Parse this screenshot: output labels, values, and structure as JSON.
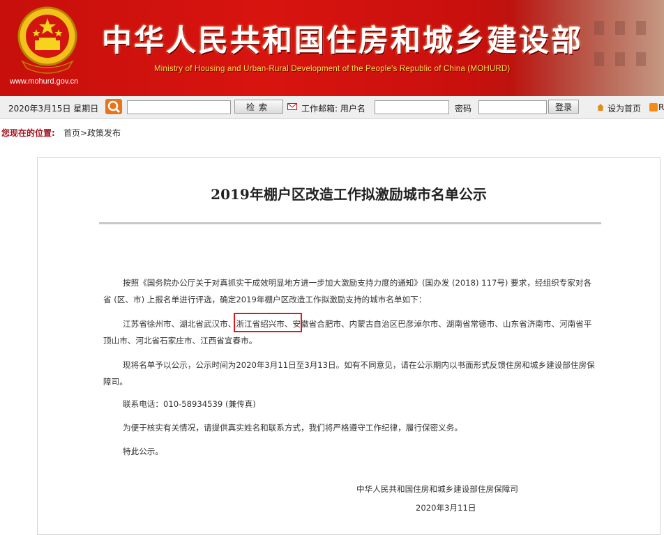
{
  "header": {
    "title": "中华人民共和国住房和城乡建设部",
    "subtitle": "Ministry of Housing and Urban-Rural Development of the People's Republic of China (MOHURD)",
    "url": "www.mohurd.gov.cn"
  },
  "toolbar": {
    "date": "2020年3月15日  星期日",
    "search_button": "检索",
    "mail_label": "工作邮箱: 用户名",
    "password_label": "密码",
    "login_button": "登录",
    "set_home": "设为首页",
    "more": "R"
  },
  "breadcrumb": {
    "label": "您现在的位置:",
    "path": "首页>政策发布"
  },
  "article": {
    "title": "2019年棚户区改造工作拟激励城市名单公示",
    "paragraphs": [
      "按照《国务院办公厅关于对真抓实干成效明显地方进一步加大激励支持力度的通知》(国办发 (2018) 117号) 要求，经组织专家对各省 (区、市) 上报名单进行评选，确定2019年棚户区改造工作拟激励支持的城市名单如下：",
      "江苏省徐州市、湖北省武汉市、浙江省绍兴市、安徽省合肥市、内蒙古自治区巴彦淖尔市、湖南省常德市、山东省济南市、河南省平顶山市、河北省石家庄市、江西省宜春市。",
      "现将名单予以公示，公示时间为2020年3月11日至3月13日。如有不同意见，请在公示期内以书面形式反馈住房和城乡建设部住房保障司。",
      "联系电话：010-58934539 (兼传真)",
      "为便于核实有关情况，请提供真实姓名和联系方式，我们将严格遵守工作纪律，履行保密义务。",
      "特此公示。"
    ],
    "signature_org": "中华人民共和国住房和城乡建设部住房保障司",
    "signature_date": "2020年3月11日"
  },
  "colors": {
    "banner_red": "#d8140f",
    "highlight_box": "#e8141b",
    "breadcrumb_label": "#a1131c",
    "subtitle_yellow": "#ffe24a"
  },
  "icons": [
    "national-emblem-icon",
    "search-icon",
    "mail-icon",
    "home-icon",
    "rss-icon"
  ]
}
